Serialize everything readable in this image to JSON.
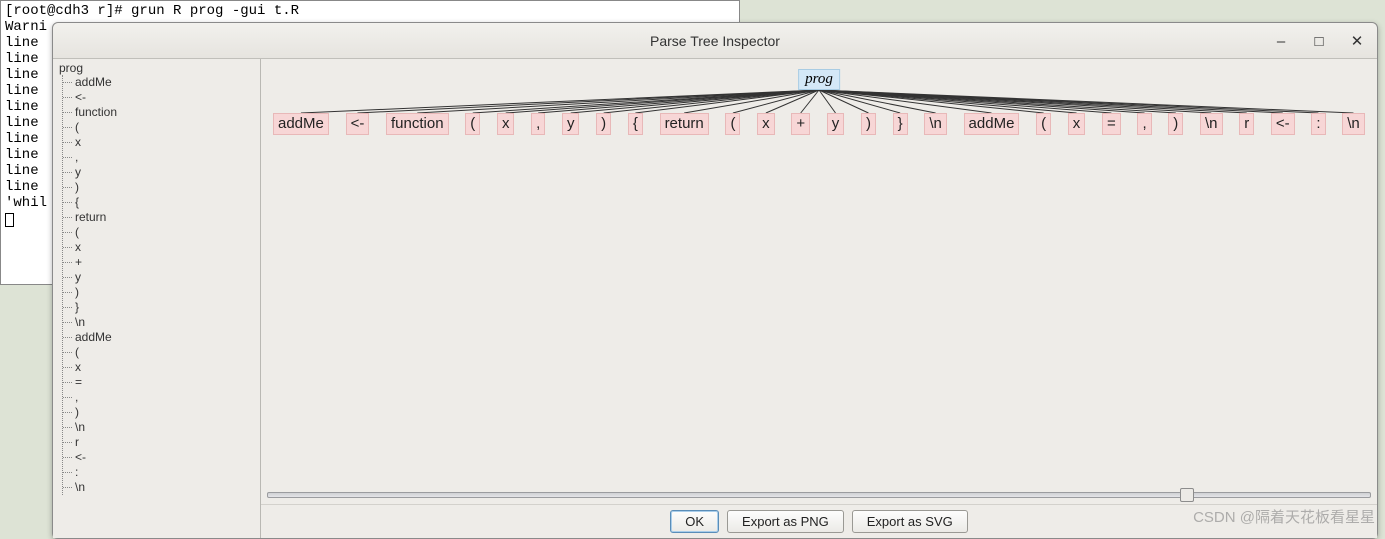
{
  "terminal": {
    "lines": [
      "[root@cdh3 r]# grun R prog -gui t.R",
      "Warni",
      "line ",
      "line ",
      "line ",
      "line ",
      "line ",
      "line ",
      "line ",
      "line ",
      "line ",
      "line ",
      "'whil"
    ]
  },
  "inspector": {
    "title": "Parse Tree Inspector",
    "win": {
      "minimize": "–",
      "maximize": "□",
      "close": "✕"
    },
    "tree": {
      "root": "prog",
      "children": [
        "addMe",
        "<-",
        "function",
        "(",
        "x",
        ",",
        "y",
        ")",
        "{",
        "return",
        "(",
        "x",
        "+",
        "y",
        ")",
        "}",
        "\\n",
        "addMe",
        "(",
        "x",
        "=",
        ",",
        ")",
        "\\n",
        "r",
        "<-",
        ":",
        "\\n"
      ]
    },
    "graph": {
      "root": "prog",
      "leaves": [
        "addMe",
        "<-",
        "function",
        "(",
        "x",
        ",",
        "y",
        ")",
        "{",
        "return",
        "(",
        "x",
        "+",
        "y",
        ")",
        "}",
        "\\n",
        "addMe",
        "(",
        "x",
        "=",
        ",",
        ")",
        "\\n",
        "r",
        "<-",
        ":",
        "\\n"
      ]
    },
    "buttons": {
      "ok": "OK",
      "png": "Export as PNG",
      "svg": "Export as SVG"
    }
  },
  "watermark": "CSDN @隔着天花板看星星"
}
